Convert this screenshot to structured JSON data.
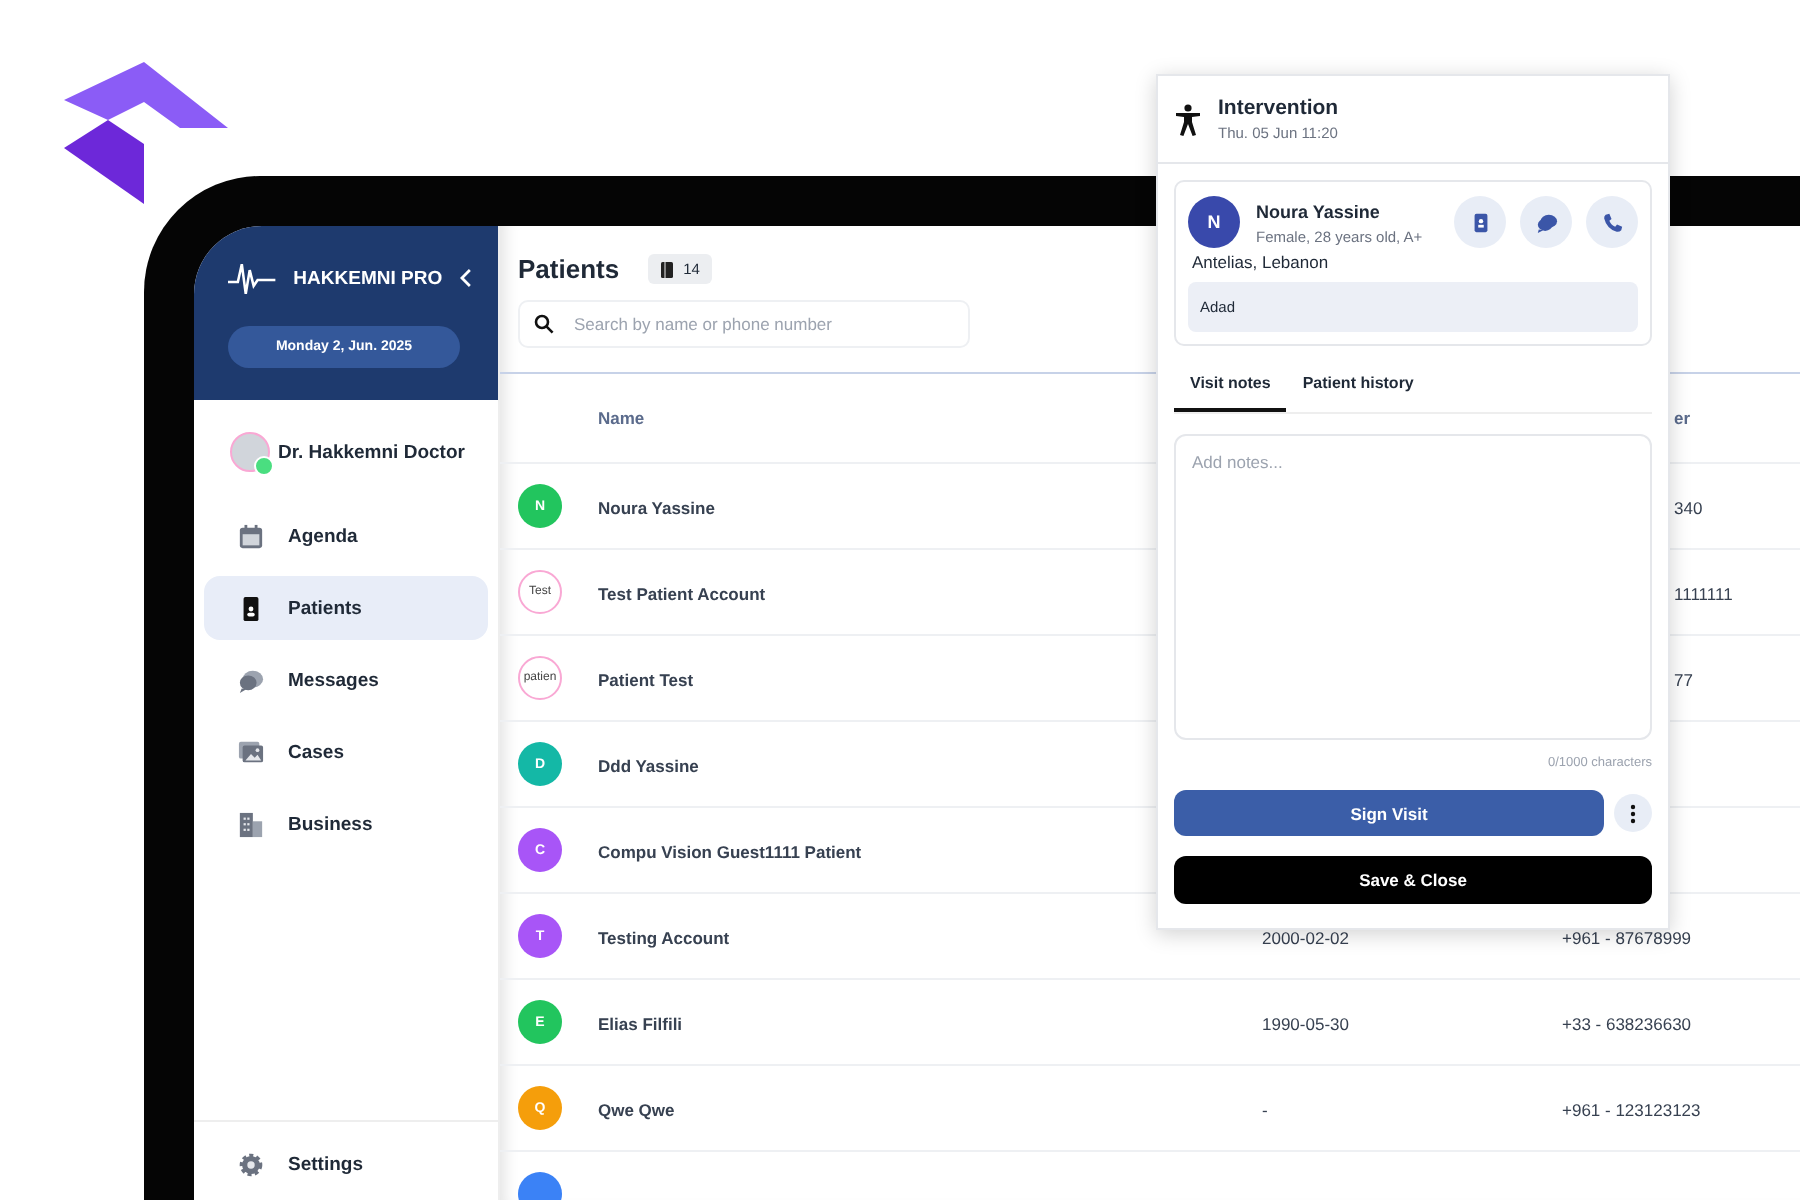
{
  "sidebar": {
    "brand": "HAKKEMNI PRO",
    "date": "Monday 2, Jun. 2025",
    "doctor": "Dr. Hakkemni Doctor",
    "items": [
      {
        "kind": "agenda",
        "label": "Agenda",
        "selected": false
      },
      {
        "kind": "patients",
        "label": "Patients",
        "selected": true
      },
      {
        "kind": "messages",
        "label": "Messages",
        "selected": false
      },
      {
        "kind": "cases",
        "label": "Cases",
        "selected": false
      },
      {
        "kind": "business",
        "label": "Business",
        "selected": false
      }
    ],
    "footer": {
      "kind": "settings",
      "label": "Settings"
    }
  },
  "main": {
    "title": "Patients",
    "count": "14",
    "search": {
      "placeholder": "Search by name or phone number"
    },
    "table": {
      "columns": [
        {
          "label": "Name",
          "covered": false
        },
        {
          "label": "er",
          "covered": true
        }
      ],
      "rows": [
        {
          "avatar": {
            "kind": "initial",
            "text": "N",
            "color": "#22c55e"
          },
          "name": "Noura Yassine",
          "phone": "340",
          "covered": true
        },
        {
          "avatar": {
            "kind": "broken_image",
            "text": "Test"
          },
          "name": "Test Patient Account",
          "phone": "1111111",
          "covered": true
        },
        {
          "avatar": {
            "kind": "broken_image",
            "text": "patien"
          },
          "name": "Patient Test",
          "phone": "77",
          "covered": true
        },
        {
          "avatar": {
            "kind": "initial",
            "text": "D",
            "color": "#14b8a6"
          },
          "name": "Ddd Yassine"
        },
        {
          "avatar": {
            "kind": "initial",
            "text": "C",
            "color": "#a855f7"
          },
          "name": "Compu Vision Guest1111 Patient"
        },
        {
          "avatar": {
            "kind": "initial",
            "text": "T",
            "color": "#a855f7"
          },
          "name": "Testing Account",
          "birth_date": "2000-02-02",
          "phone": "+961 - 87678999",
          "covered": false
        },
        {
          "avatar": {
            "kind": "initial",
            "text": "E",
            "color": "#22c55e"
          },
          "name": "Elias Filfili",
          "birth_date": "1990-05-30",
          "phone": "+33 - 638236630",
          "covered": false
        },
        {
          "avatar": {
            "kind": "initial",
            "text": "Q",
            "color": "#f59e0b"
          },
          "name": "Qwe Qwe",
          "birth_date": "-",
          "phone": "+961 - 123123123",
          "covered": false
        },
        {
          "avatar": {
            "kind": "initial",
            "color": "#3b82f6"
          }
        }
      ]
    }
  },
  "panel": {
    "title": "Intervention",
    "datetime": "Thu. 05 Jun 11:20",
    "patient": {
      "initial": "N",
      "name": "Noura Yassine",
      "details": "Female, 28 years old, A+",
      "location": "Antelias, Lebanon",
      "note": "Adad",
      "actions": [
        {
          "kind": "card"
        },
        {
          "kind": "chat"
        },
        {
          "kind": "phone"
        }
      ]
    },
    "tabs": [
      {
        "label": "Visit notes",
        "selected": true
      },
      {
        "label": "Patient history",
        "selected": false
      }
    ],
    "notes": {
      "placeholder": "Add notes..."
    },
    "counter": "0/1000 characters",
    "sign_button": "Sign Visit",
    "save_button": "Save & Close"
  }
}
